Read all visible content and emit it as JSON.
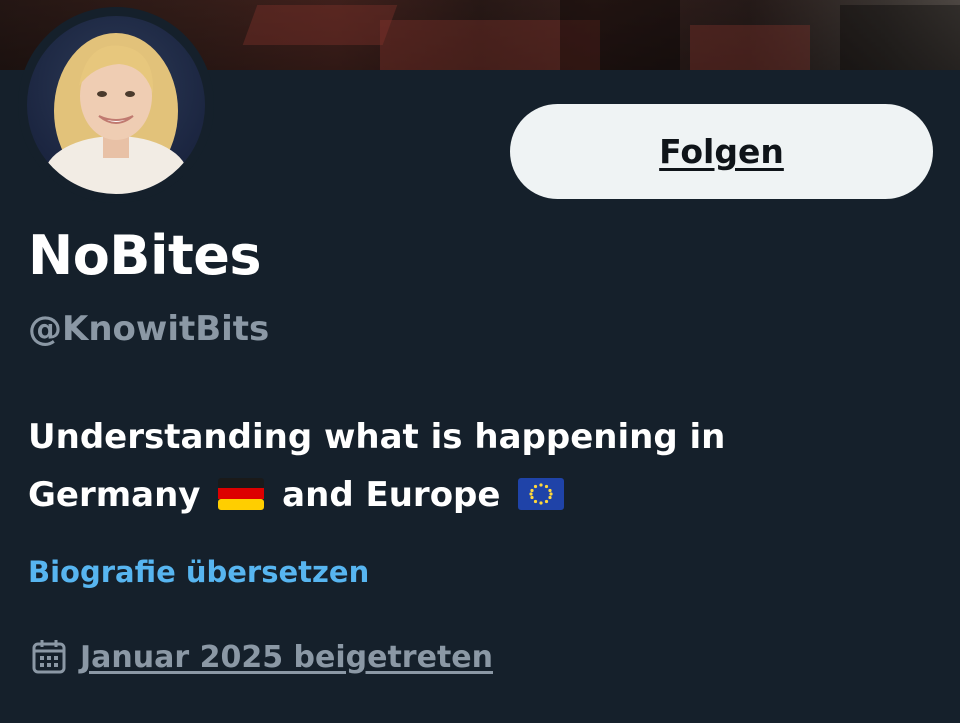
{
  "profile": {
    "display_name": "NoBites",
    "handle": "@KnowitBits",
    "bio_line1": "Understanding what is happening in",
    "bio_line2_before": "Germany",
    "bio_line2_middle": "and Europe",
    "translate_link": "Biografie übersetzen",
    "joined": "Januar 2025 beigetreten"
  },
  "actions": {
    "follow_label": "Folgen"
  },
  "icons": {
    "flag_de": "germany-flag-icon",
    "flag_eu": "eu-flag-icon",
    "calendar": "calendar-icon"
  },
  "colors": {
    "background": "#15202b",
    "link": "#57b5f0",
    "secondary_text": "#8b98a5",
    "button_bg": "#eff3f4"
  }
}
